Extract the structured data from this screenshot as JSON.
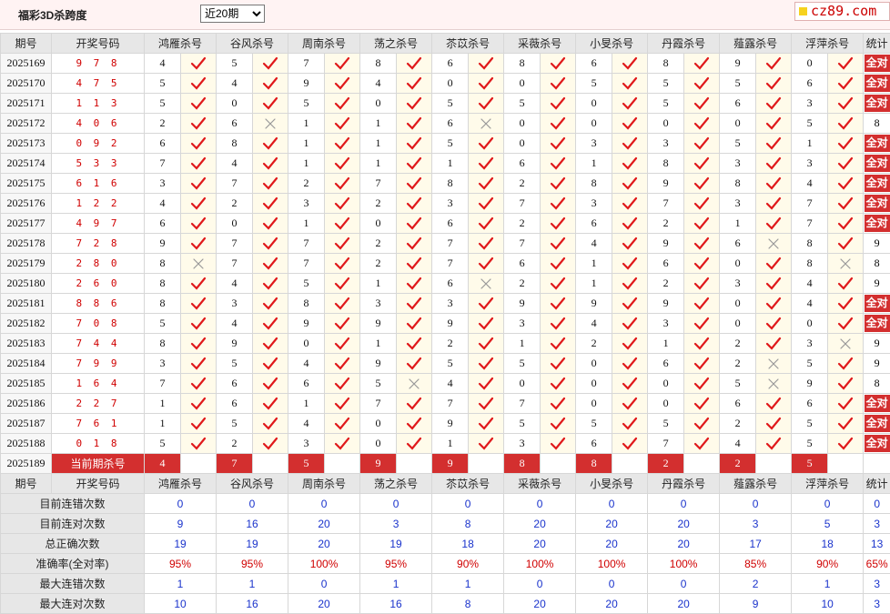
{
  "header": {
    "title": "福彩3D杀跨度",
    "range_selected": "近20期",
    "site": "cz89.com"
  },
  "columns": {
    "period": "期号",
    "numbers": "开奖号码",
    "experts": [
      "鸿雁杀号",
      "谷风杀号",
      "周南杀号",
      "荡之杀号",
      "苶苡杀号",
      "采薇杀号",
      "小旻杀号",
      "丹霞杀号",
      "薤露杀号",
      "浮萍杀号"
    ],
    "stat": "统计"
  },
  "all_correct_label": "全对",
  "current_label": "当前期杀号",
  "rows": [
    {
      "period": "2025169",
      "numbers": "9 7 8",
      "vals": [
        "4",
        "5",
        "7",
        "8",
        "6",
        "8",
        "6",
        "8",
        "9",
        "0"
      ],
      "ok": [
        1,
        1,
        1,
        1,
        1,
        1,
        1,
        1,
        1,
        1
      ],
      "stat": "全对"
    },
    {
      "period": "2025170",
      "numbers": "4 7 5",
      "vals": [
        "5",
        "4",
        "9",
        "4",
        "0",
        "0",
        "5",
        "5",
        "5",
        "6"
      ],
      "ok": [
        1,
        1,
        1,
        1,
        1,
        1,
        1,
        1,
        1,
        1
      ],
      "stat": "全对"
    },
    {
      "period": "2025171",
      "numbers": "1 1 3",
      "vals": [
        "5",
        "0",
        "5",
        "0",
        "5",
        "5",
        "0",
        "5",
        "6",
        "3"
      ],
      "ok": [
        1,
        1,
        1,
        1,
        1,
        1,
        1,
        1,
        1,
        1
      ],
      "stat": "全对"
    },
    {
      "period": "2025172",
      "numbers": "4 0 6",
      "vals": [
        "2",
        "6",
        "1",
        "1",
        "6",
        "0",
        "0",
        "0",
        "0",
        "5"
      ],
      "ok": [
        1,
        0,
        1,
        1,
        0,
        1,
        1,
        1,
        1,
        1
      ],
      "stat": "8"
    },
    {
      "period": "2025173",
      "numbers": "0 9 2",
      "vals": [
        "6",
        "8",
        "1",
        "1",
        "5",
        "0",
        "3",
        "3",
        "5",
        "1"
      ],
      "ok": [
        1,
        1,
        1,
        1,
        1,
        1,
        1,
        1,
        1,
        1
      ],
      "stat": "全对"
    },
    {
      "period": "2025174",
      "numbers": "5 3 3",
      "vals": [
        "7",
        "4",
        "1",
        "1",
        "1",
        "6",
        "1",
        "8",
        "3",
        "3"
      ],
      "ok": [
        1,
        1,
        1,
        1,
        1,
        1,
        1,
        1,
        1,
        1
      ],
      "stat": "全对"
    },
    {
      "period": "2025175",
      "numbers": "6 1 6",
      "vals": [
        "3",
        "7",
        "2",
        "7",
        "8",
        "2",
        "8",
        "9",
        "8",
        "4"
      ],
      "ok": [
        1,
        1,
        1,
        1,
        1,
        1,
        1,
        1,
        1,
        1
      ],
      "stat": "全对"
    },
    {
      "period": "2025176",
      "numbers": "1 2 2",
      "vals": [
        "4",
        "2",
        "3",
        "2",
        "3",
        "7",
        "3",
        "7",
        "3",
        "7"
      ],
      "ok": [
        1,
        1,
        1,
        1,
        1,
        1,
        1,
        1,
        1,
        1
      ],
      "stat": "全对"
    },
    {
      "period": "2025177",
      "numbers": "4 9 7",
      "vals": [
        "6",
        "0",
        "1",
        "0",
        "6",
        "2",
        "6",
        "2",
        "1",
        "7"
      ],
      "ok": [
        1,
        1,
        1,
        1,
        1,
        1,
        1,
        1,
        1,
        1
      ],
      "stat": "全对"
    },
    {
      "period": "2025178",
      "numbers": "7 2 8",
      "vals": [
        "9",
        "7",
        "7",
        "2",
        "7",
        "7",
        "4",
        "9",
        "6",
        "8"
      ],
      "ok": [
        1,
        1,
        1,
        1,
        1,
        1,
        1,
        1,
        0,
        1
      ],
      "stat": "9"
    },
    {
      "period": "2025179",
      "numbers": "2 8 0",
      "vals": [
        "8",
        "7",
        "7",
        "2",
        "7",
        "6",
        "1",
        "6",
        "0",
        "8"
      ],
      "ok": [
        0,
        1,
        1,
        1,
        1,
        1,
        1,
        1,
        1,
        0
      ],
      "stat": "8"
    },
    {
      "period": "2025180",
      "numbers": "2 6 0",
      "vals": [
        "8",
        "4",
        "5",
        "1",
        "6",
        "2",
        "1",
        "2",
        "3",
        "4"
      ],
      "ok": [
        1,
        1,
        1,
        1,
        0,
        1,
        1,
        1,
        1,
        1
      ],
      "stat": "9"
    },
    {
      "period": "2025181",
      "numbers": "8 8 6",
      "vals": [
        "8",
        "3",
        "8",
        "3",
        "3",
        "9",
        "9",
        "9",
        "0",
        "4"
      ],
      "ok": [
        1,
        1,
        1,
        1,
        1,
        1,
        1,
        1,
        1,
        1
      ],
      "stat": "全对"
    },
    {
      "period": "2025182",
      "numbers": "7 0 8",
      "vals": [
        "5",
        "4",
        "9",
        "9",
        "9",
        "3",
        "4",
        "3",
        "0",
        "0"
      ],
      "ok": [
        1,
        1,
        1,
        1,
        1,
        1,
        1,
        1,
        1,
        1
      ],
      "stat": "全对"
    },
    {
      "period": "2025183",
      "numbers": "7 4 4",
      "vals": [
        "8",
        "9",
        "0",
        "1",
        "2",
        "1",
        "2",
        "1",
        "2",
        "3"
      ],
      "ok": [
        1,
        1,
        1,
        1,
        1,
        1,
        1,
        1,
        1,
        0
      ],
      "stat": "9"
    },
    {
      "period": "2025184",
      "numbers": "7 9 9",
      "vals": [
        "3",
        "5",
        "4",
        "9",
        "5",
        "5",
        "0",
        "6",
        "2",
        "5"
      ],
      "ok": [
        1,
        1,
        1,
        1,
        1,
        1,
        1,
        1,
        0,
        1
      ],
      "stat": "9"
    },
    {
      "period": "2025185",
      "numbers": "1 6 4",
      "vals": [
        "7",
        "6",
        "6",
        "5",
        "4",
        "0",
        "0",
        "0",
        "5",
        "9"
      ],
      "ok": [
        1,
        1,
        1,
        0,
        1,
        1,
        1,
        1,
        0,
        1
      ],
      "stat": "8"
    },
    {
      "period": "2025186",
      "numbers": "2 2 7",
      "vals": [
        "1",
        "6",
        "1",
        "7",
        "7",
        "7",
        "0",
        "0",
        "6",
        "6"
      ],
      "ok": [
        1,
        1,
        1,
        1,
        1,
        1,
        1,
        1,
        1,
        1
      ],
      "stat": "全对"
    },
    {
      "period": "2025187",
      "numbers": "7 6 1",
      "vals": [
        "1",
        "5",
        "4",
        "0",
        "9",
        "5",
        "5",
        "5",
        "2",
        "5"
      ],
      "ok": [
        1,
        1,
        1,
        1,
        1,
        1,
        1,
        1,
        1,
        1
      ],
      "stat": "全对"
    },
    {
      "period": "2025188",
      "numbers": "0 1 8",
      "vals": [
        "5",
        "2",
        "3",
        "0",
        "1",
        "3",
        "6",
        "7",
        "4",
        "5"
      ],
      "ok": [
        1,
        1,
        1,
        1,
        1,
        1,
        1,
        1,
        1,
        1
      ],
      "stat": "全对"
    }
  ],
  "current": {
    "period": "2025189",
    "vals": [
      "4",
      "7",
      "5",
      "9",
      "9",
      "8",
      "8",
      "2",
      "2",
      "5"
    ]
  },
  "stats": [
    {
      "label": "目前连错次数",
      "values": [
        "0",
        "0",
        "0",
        "0",
        "0",
        "0",
        "0",
        "0",
        "0",
        "0"
      ],
      "total": "0",
      "color": "#1a33cc"
    },
    {
      "label": "目前连对次数",
      "values": [
        "9",
        "16",
        "20",
        "3",
        "8",
        "20",
        "20",
        "20",
        "3",
        "5"
      ],
      "total": "3",
      "color": "#1a33cc"
    },
    {
      "label": "总正确次数",
      "values": [
        "19",
        "19",
        "20",
        "19",
        "18",
        "20",
        "20",
        "20",
        "17",
        "18"
      ],
      "total": "13",
      "color": "#1a33cc"
    },
    {
      "label": "准确率(全对率)",
      "values": [
        "95%",
        "95%",
        "100%",
        "95%",
        "90%",
        "100%",
        "100%",
        "100%",
        "85%",
        "90%"
      ],
      "total": "65%",
      "color": "#d00000"
    },
    {
      "label": "最大连错次数",
      "values": [
        "1",
        "1",
        "0",
        "1",
        "1",
        "0",
        "0",
        "0",
        "2",
        "1"
      ],
      "total": "3",
      "color": "#1a33cc"
    },
    {
      "label": "最大连对次数",
      "values": [
        "10",
        "16",
        "20",
        "16",
        "8",
        "20",
        "20",
        "20",
        "9",
        "10"
      ],
      "total": "3",
      "color": "#1a33cc"
    }
  ]
}
